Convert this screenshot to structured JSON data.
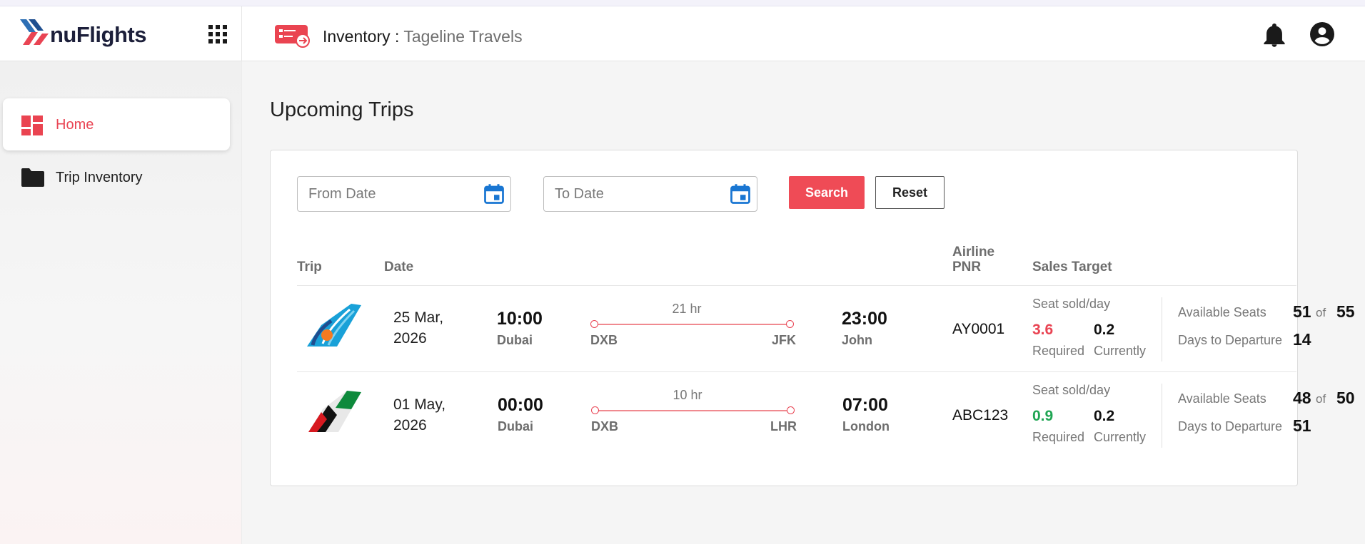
{
  "header": {
    "logo_text": "nuFlights",
    "title_label": "Inventory :",
    "title_org": "Tageline Travels",
    "icons": [
      "apps-grid-icon",
      "inventory-ticket-icon",
      "bell-icon",
      "account-circle-icon"
    ]
  },
  "sidebar": {
    "items": [
      {
        "label": "Home",
        "icon": "dashboard-icon",
        "active": true
      },
      {
        "label": "Trip Inventory",
        "icon": "folder-icon",
        "active": false
      }
    ]
  },
  "main": {
    "title": "Upcoming Trips",
    "filters": {
      "from_placeholder": "From Date",
      "to_placeholder": "To Date",
      "search_label": "Search",
      "reset_label": "Reset"
    },
    "table": {
      "headers": {
        "trip": "Trip",
        "date": "Date",
        "pnr_line1": "Airline",
        "pnr_line2": "PNR",
        "sales_target": "Sales Target"
      },
      "rows": [
        {
          "airline_logo": "flydubai-tail-logo",
          "date_line1": "25 Mar,",
          "date_line2": "2026",
          "dep_time": "10:00",
          "dep_city": "Dubai",
          "duration": "21 hr",
          "from_code": "DXB",
          "to_code": "JFK",
          "arr_time": "23:00",
          "arr_city": "John",
          "pnr": "AY0001",
          "seat_sold_label": "Seat sold/day",
          "required_value": "3.6",
          "required_status": "red",
          "required_label": "Required",
          "current_value": "0.2",
          "current_label": "Currently",
          "available_label": "Available Seats",
          "available": "51",
          "of_label": "of",
          "total": "55",
          "days_label": "Days to Departure",
          "days": "14"
        },
        {
          "airline_logo": "emirates-tail-logo",
          "date_line1": "01 May,",
          "date_line2": "2026",
          "dep_time": "00:00",
          "dep_city": "Dubai",
          "duration": "10 hr",
          "from_code": "DXB",
          "to_code": "LHR",
          "arr_time": "07:00",
          "arr_city": "London",
          "pnr": "ABC123",
          "seat_sold_label": "Seat sold/day",
          "required_value": "0.9",
          "required_status": "green",
          "required_label": "Required",
          "current_value": "0.2",
          "current_label": "Currently",
          "available_label": "Available Seats",
          "available": "48",
          "of_label": "of",
          "total": "50",
          "days_label": "Days to Departure",
          "days": "51"
        }
      ]
    }
  },
  "colors": {
    "accent": "#e94453",
    "search_button": "#ef4b56",
    "success": "#1fa553",
    "calendar_icon": "#1976d2"
  }
}
